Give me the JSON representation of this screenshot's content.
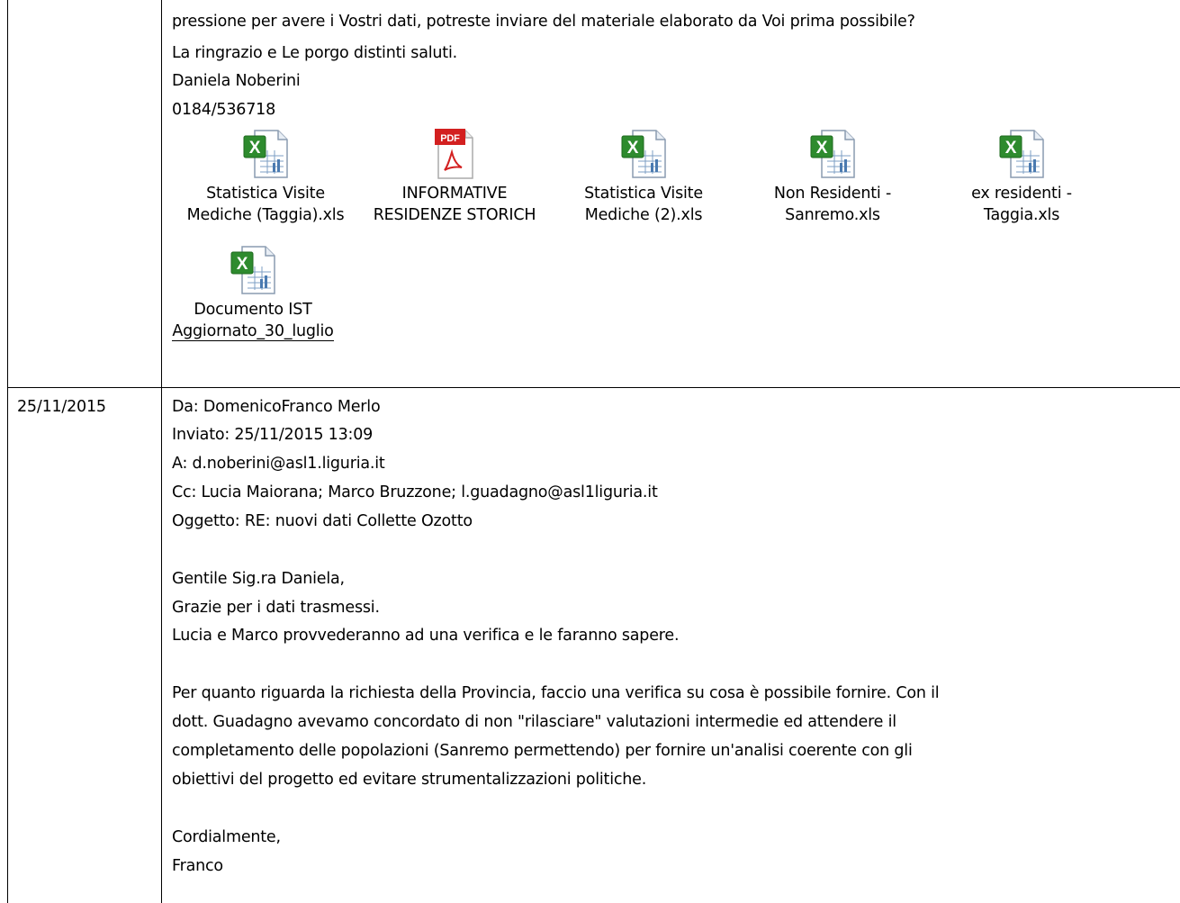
{
  "row1": {
    "lines": [
      "pressione per avere i Vostri dati, potreste inviare del materiale elaborato da Voi prima possibile?",
      "La ringrazio e Le porgo distinti saluti.",
      "Daniela Noberini",
      "0184/536718"
    ],
    "attachments": [
      {
        "icon": "excel-icon",
        "line1": "Statistica Visite",
        "line2": "Mediche (Taggia).xls"
      },
      {
        "icon": "pdf-icon",
        "badge": "PDF",
        "line1": "INFORMATIVE",
        "line2": "RESIDENZE STORICH"
      },
      {
        "icon": "excel-icon",
        "line1": "Statistica Visite",
        "line2": "Mediche (2).xls"
      },
      {
        "icon": "excel-icon",
        "line1": "Non Residenti -",
        "line2": "Sanremo.xls"
      },
      {
        "icon": "excel-icon",
        "line1": "ex residenti -",
        "line2": "Taggia.xls"
      },
      {
        "icon": "excel-icon",
        "line1": "Documento IST",
        "line2": "Aggiornato_30_luglio"
      }
    ]
  },
  "row2": {
    "date": "25/11/2015",
    "header": [
      "Da: DomenicoFranco Merlo",
      "Inviato: 25/11/2015 13:09",
      "A: d.noberini@asl1.liguria.it",
      "Cc: Lucia Maiorana; Marco Bruzzone; l.guadagno@asl1liguria.it",
      "Oggetto: RE: nuovi dati Collette Ozotto"
    ],
    "body1": [
      "Gentile Sig.ra Daniela,",
      "Grazie per i dati trasmessi.",
      "Lucia e Marco provvederanno ad una verifica e le faranno sapere."
    ],
    "body2": [
      "Per quanto riguarda  la richiesta della Provincia, faccio una verifica su cosa è possibile fornire. Con il",
      "dott. Guadagno avevamo concordato di non \"rilasciare\" valutazioni intermedie ed attendere il",
      "completamento delle popolazioni (Sanremo  permettendo) per fornire un'analisi coerente con gli",
      "obiettivi del progetto ed evitare strumentalizzazioni politiche."
    ],
    "closing": [
      "Cordialmente,",
      "Franco"
    ]
  },
  "colors": {
    "excel_green": "#2e8b2e",
    "pdf_red": "#d32020",
    "border": "#000000"
  }
}
